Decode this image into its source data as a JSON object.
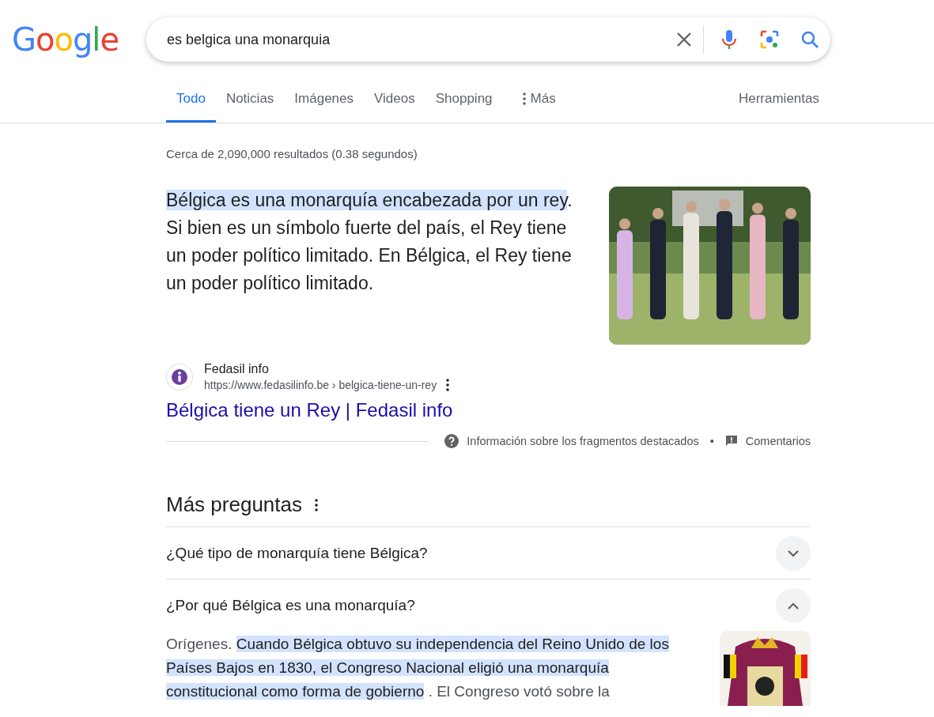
{
  "logo": "Google",
  "search": {
    "value": "es belgica una monarquia"
  },
  "tabs": [
    {
      "label": "Todo",
      "selected": true
    },
    {
      "label": "Noticias",
      "selected": false
    },
    {
      "label": "Imágenes",
      "selected": false
    },
    {
      "label": "Videos",
      "selected": false
    },
    {
      "label": "Shopping",
      "selected": false
    },
    {
      "label": "Más",
      "selected": false,
      "kind": "more"
    }
  ],
  "tools": "Herramientas",
  "stats": "Cerca de 2,090,000 resultados (0.38 segundos)",
  "featured": {
    "highlighted": "Bélgica es una monarquía encabezada por un rey",
    "rest": ". Si bien es un símbolo fuerte del país, el Rey tiene un poder político limitado. En Bélgica, el Rey tiene un poder político limitado."
  },
  "source": {
    "site": "Fedasil info",
    "url": "https://www.fedasilinfo.be › belgica-tiene-un-rey",
    "title": "Bélgica tiene un Rey | Fedasil info"
  },
  "footer": {
    "about": "Información sobre los fragmentos destacados",
    "separator": "•",
    "feedback": "Comentarios"
  },
  "questions_title": "Más preguntas",
  "questions": [
    {
      "question": "¿Qué tipo de monarquía tiene Bélgica?",
      "expanded": false
    },
    {
      "question": "¿Por qué Bélgica es una monarquía?",
      "expanded": true,
      "answer": {
        "lead": "Orígenes. ",
        "highlighted": "Cuando Bélgica obtuvo su independencia del Reino Unido de los Países Bajos en 1830, el Congreso Nacional eligió una monarquía constitucional como forma de gobierno",
        "rest": " . El Congreso votó sobre la"
      }
    }
  ]
}
